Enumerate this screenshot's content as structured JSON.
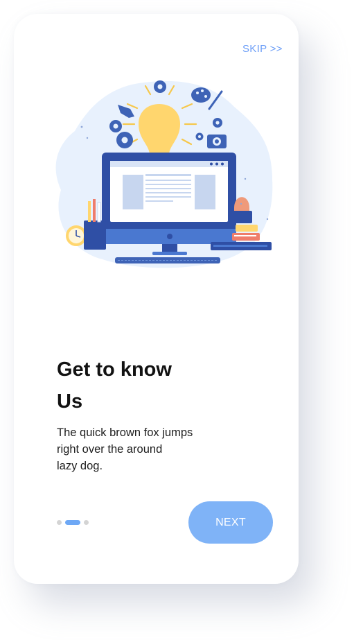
{
  "header": {
    "skip_label": "SKIP >>"
  },
  "onboarding": {
    "title_line1": "Get to know",
    "title_line2": "Us",
    "description_line1": "The quick brown fox jumps",
    "description_line2": "right over the around",
    "description_line3": "lazy dog.",
    "page_indicator": {
      "total": 3,
      "active": 2
    },
    "next_label": "NEXT"
  },
  "illustration": {
    "subject": "lightbulb-computer-creativity",
    "icons": [
      "lightbulb-icon",
      "gear-icon",
      "pen-nib-icon",
      "palette-icon",
      "camera-icon",
      "monitor-icon",
      "clock-icon",
      "cactus-icon",
      "books-icon",
      "keyboard-icon"
    ]
  },
  "colors": {
    "accent": "#6c9ef7",
    "button": "#7fb3f7",
    "active_dot": "#6ea8f5",
    "inactive_dot": "#d4d4d4",
    "monitor": "#2f4fa5",
    "bulb": "#ffd66e",
    "blob": "#e8f1fd"
  }
}
